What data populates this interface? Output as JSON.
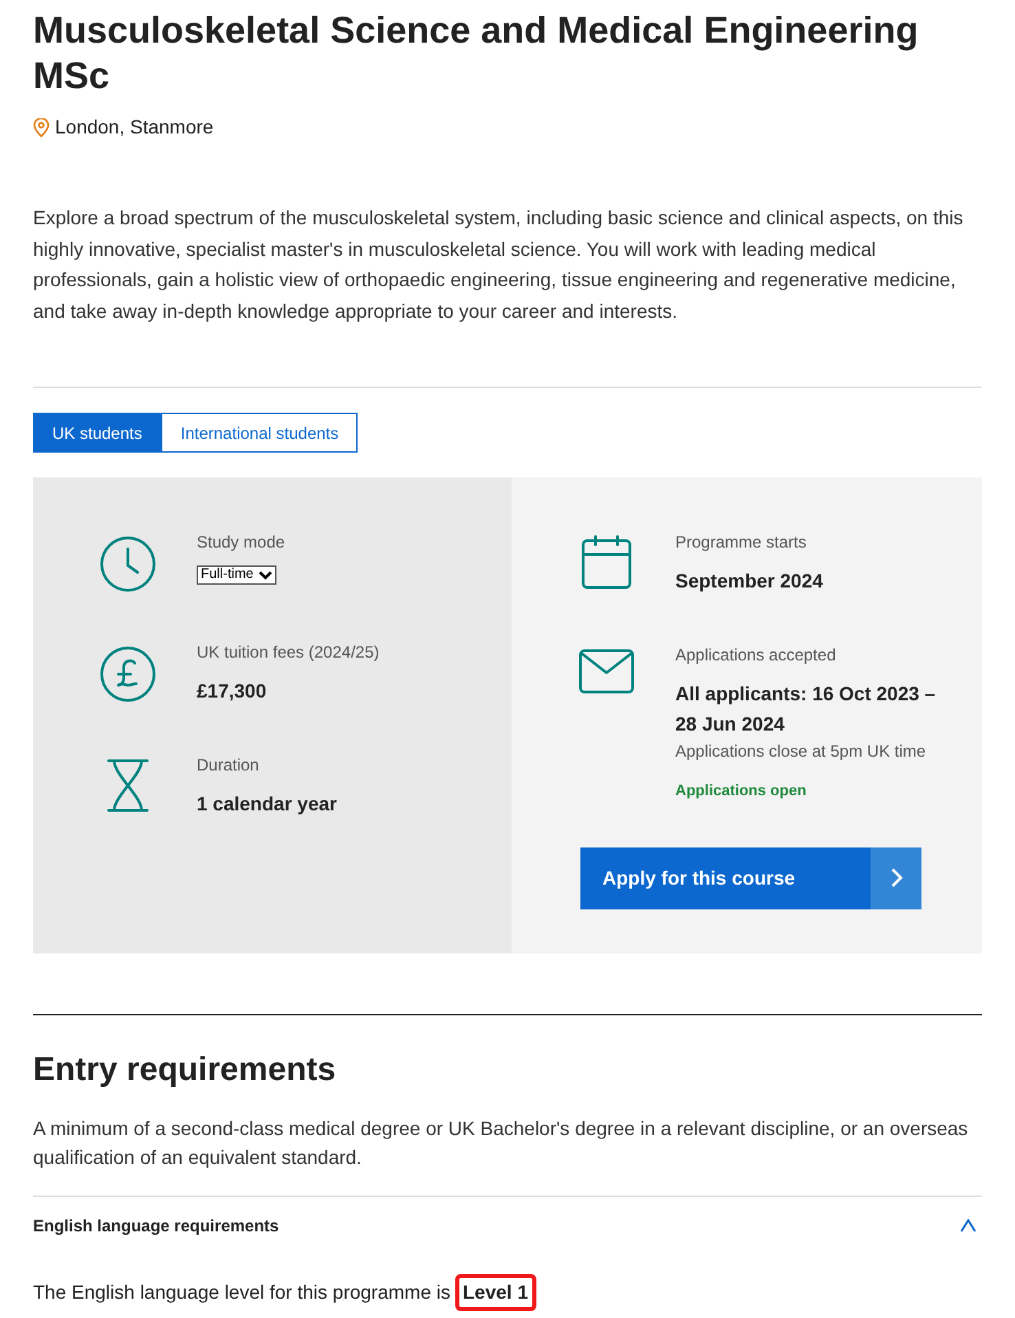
{
  "title": "Musculoskeletal Science and Medical Engineering MSc",
  "location": "London, Stanmore",
  "intro": "Explore a broad spectrum of the musculoskeletal system, including basic science and clinical aspects, on this highly innovative, specialist master's in musculoskeletal science. You will work with leading medical professionals, gain a holistic view of orthopaedic engineering, tissue engineering and regenerative medicine, and take away in-depth knowledge appropriate to your career and interests.",
  "tabs": [
    {
      "label": "UK students",
      "selected": true
    },
    {
      "label": "International students",
      "selected": false
    }
  ],
  "facts_left": [
    {
      "kind": "select",
      "label": "Study mode",
      "value": "Full-time"
    },
    {
      "kind": "value",
      "label": "UK tuition fees (2024/25)",
      "value": "£17,300"
    },
    {
      "kind": "value",
      "label": "Duration",
      "value": "1 calendar year"
    }
  ],
  "facts_right": [
    {
      "kind": "value",
      "label": "Programme starts",
      "value": "September 2024"
    },
    {
      "kind": "value",
      "label": "Applications accepted",
      "value": "All applicants: 16 Oct 2023 – 28 Jun 2024",
      "note": "Applications close at 5pm UK time",
      "status": "Applications open"
    }
  ],
  "apply_button": "Apply for this course",
  "entry": {
    "heading": "Entry requirements",
    "text": "A minimum of a second-class medical degree or UK Bachelor's degree in a relevant discipline, or an overseas qualification of an equivalent standard.",
    "accordion": {
      "title": "English language requirements",
      "expanded": true,
      "text": "The English language level for this programme is",
      "level": "Level 1",
      "highlighted": true
    }
  }
}
